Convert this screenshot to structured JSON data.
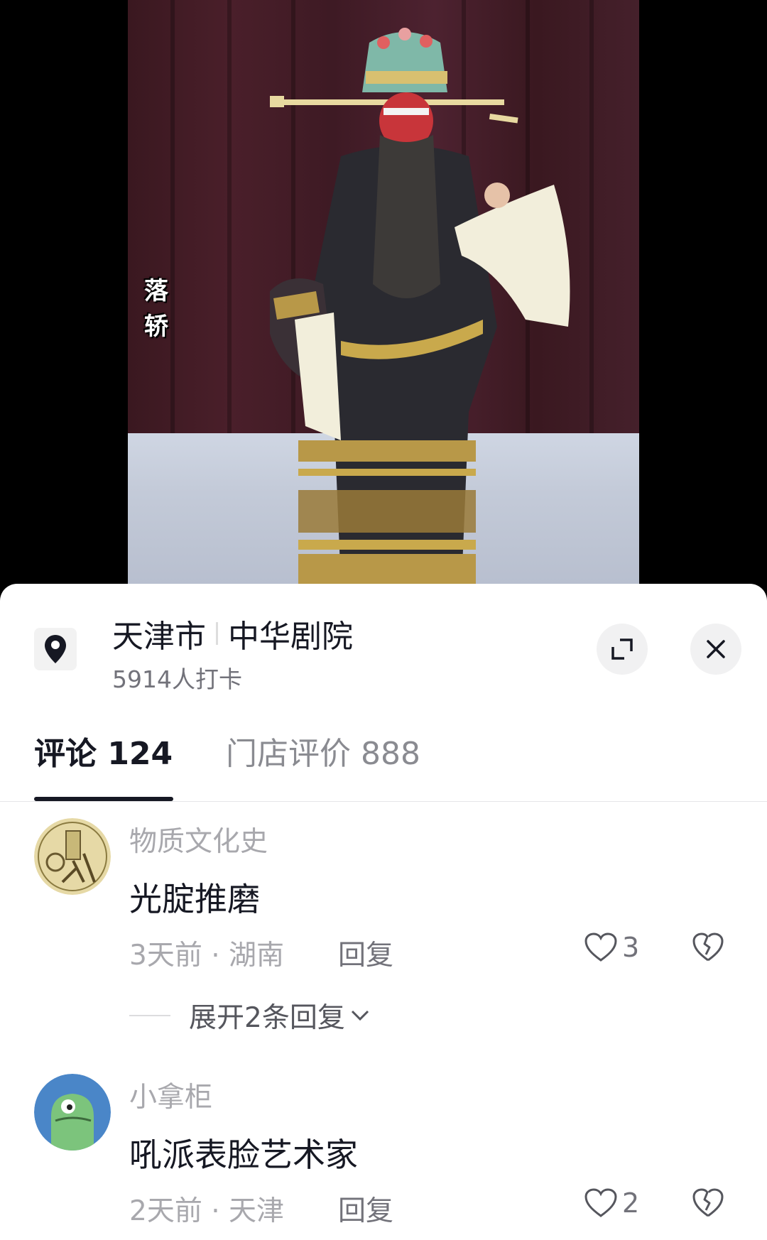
{
  "video": {
    "overlay_text": [
      "落",
      "轿"
    ]
  },
  "location": {
    "city": "天津市",
    "venue": "中华剧院",
    "checkins": "5914人打卡",
    "icon": "location-pin-icon"
  },
  "tabs": [
    {
      "label": "评论 124",
      "active": true
    },
    {
      "label": "门店评价 888",
      "active": false
    }
  ],
  "comments": [
    {
      "name": "物质文化史",
      "text": "光腚推磨",
      "meta": "3天前 · 湖南",
      "reply": "回复",
      "likes": "3",
      "expand": "展开2条回复"
    },
    {
      "name": "小拿柜",
      "text": "吼派表脸艺术家",
      "meta": "2天前 · 天津",
      "reply": "回复",
      "likes": "2"
    }
  ],
  "colors": {
    "text_primary": "#161823",
    "text_secondary": "#a8a8ad",
    "sheet_bg": "#ffffff"
  }
}
